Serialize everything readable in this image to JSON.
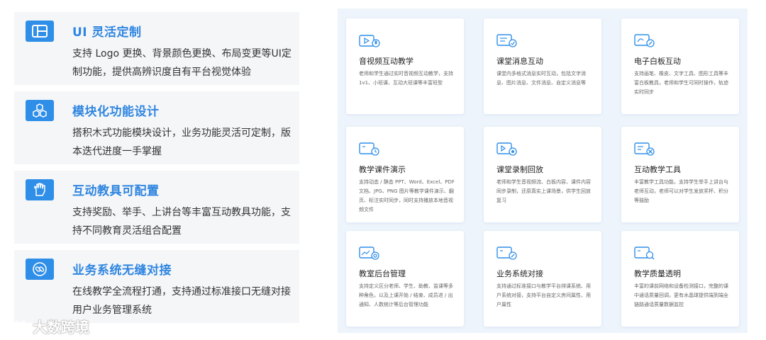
{
  "features": [
    {
      "title": "UI 灵活定制",
      "desc": "支持 Logo 更换、背景颜色更换、布局变更等UI定制功能，提供高辨识度自有平台视觉体验",
      "icon": "layout-icon"
    },
    {
      "title": "模块化功能设计",
      "desc": "搭积木式功能模块设计，业务功能灵活可定制，版本迭代进度一手掌握",
      "icon": "cubes-icon"
    },
    {
      "title": "互动教具可配置",
      "desc": "支持奖励、举手、上讲台等丰富互动教具功能，支持不同教育灵活组合配置",
      "icon": "hand-icon"
    },
    {
      "title": "业务系统无缝对接",
      "desc": "在线教学全流程打通，支持通过标准接口无缝对接用户业务管理系统",
      "icon": "link-icon"
    }
  ],
  "cards": [
    {
      "title": "音视频互动教学",
      "desc": "老师和学生通过实时音视频互动教学，支持 1v1、小班课、互动大班课等丰富班型",
      "icon": "video-mic-icon"
    },
    {
      "title": "课堂消息互动",
      "desc": "课堂内多格式消息实时互动，包括文字消息、图片消息、文件消息、自定义消息等",
      "icon": "message-icon"
    },
    {
      "title": "电子白板互动",
      "desc": "支持画笔、橡皮、文字工具、图形工具等丰富白板教具，老师和学生可同时操作，轨迹实时同步",
      "icon": "whiteboard-icon"
    },
    {
      "title": "教学课件演示",
      "desc": "支持动态 / 静态 PPT、Word、Excel、PDF 文档、JPG、PNG 图片等教学课件演示、翻页、标注实时同步，同时支持播放本地音视频文件",
      "icon": "courseware-icon"
    },
    {
      "title": "课堂录制回放",
      "desc": "老师和学生音视频流、白板内容、课件内容同步录制，还原真实上课场景，供学生回放复习",
      "icon": "record-icon"
    },
    {
      "title": "互动教学工具",
      "desc": "丰富教学工具功能，支持学生举手上讲台与老师互动，老师可以对学生发放奖杯、积分等鼓励",
      "icon": "tools-icon"
    },
    {
      "title": "教室后台管理",
      "desc": "支持定义区分老师、学生、助教、监课等多种角色，以及上课开始 / 结束、成员进 / 出通知、人数统计等后台管理功能",
      "icon": "admin-icon"
    },
    {
      "title": "业务系统对接",
      "desc": "支持通过标准接口与教学平台排课系统、用户系统对接，支持平台自定义房间属性、用户属性",
      "icon": "connect-icon"
    },
    {
      "title": "教学质量透明",
      "desc": "丰富的课前网络和设备检测接口，完整的课中通话质量回调，更有水晶球提供端到端全链路通话质量数据监控",
      "icon": "quality-icon"
    }
  ],
  "watermark": {
    "text": "大数跨境",
    "icon": "watermark-logo-icon"
  },
  "colors": {
    "accent": "#2f8ee8",
    "title": "#2f86e0",
    "card_bg": "#ffffff",
    "grid_bg": "#eef4fb"
  }
}
